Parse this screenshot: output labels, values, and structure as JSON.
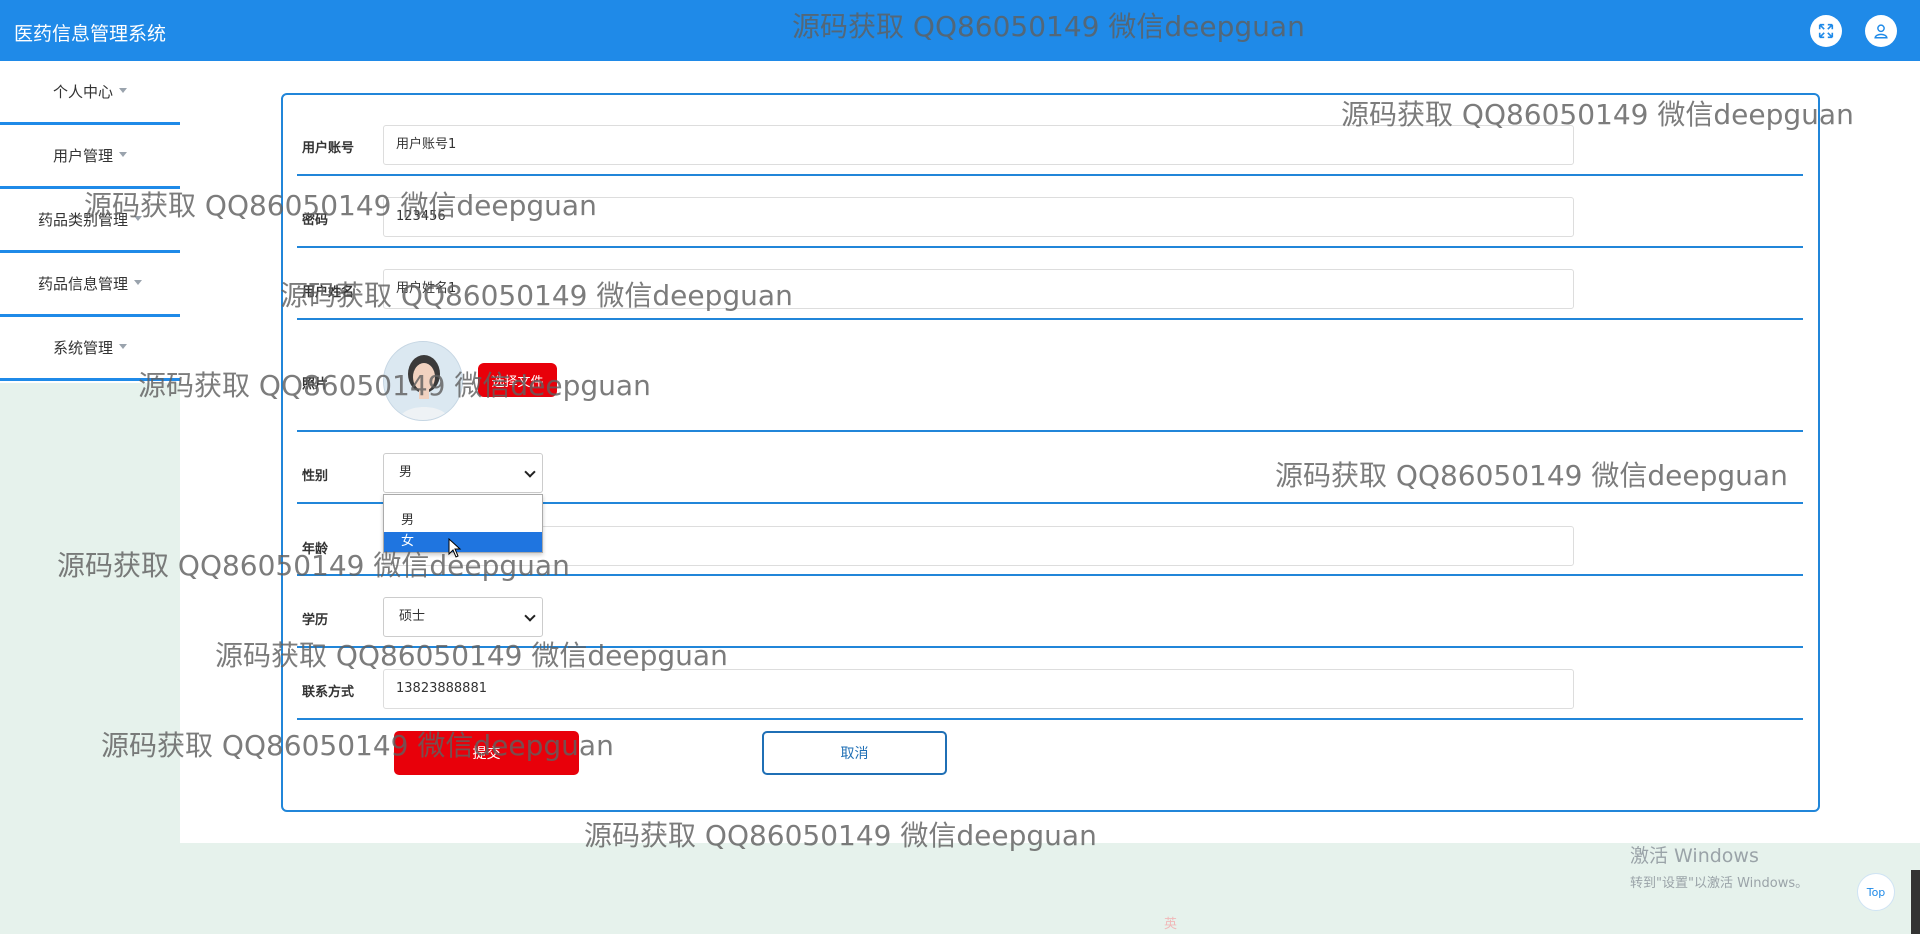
{
  "header": {
    "app_title": "医药信息管理系统"
  },
  "sidebar": {
    "items": [
      {
        "label": "个人中心"
      },
      {
        "label": "用户管理"
      },
      {
        "label": "药品类别管理"
      },
      {
        "label": "药品信息管理"
      },
      {
        "label": "系统管理"
      }
    ]
  },
  "form": {
    "account_label": "用户账号",
    "account_value": "用户账号1",
    "password_label": "密码",
    "password_value": "123456",
    "name_label": "用户姓名",
    "name_value": "用户姓名1",
    "photo_label": "照片",
    "choose_file_label": "选择文件",
    "gender_label": "性别",
    "gender_value": "男",
    "gender_options": [
      "男",
      "女"
    ],
    "gender_highlighted": "女",
    "age_label": "年龄",
    "education_label": "学历",
    "education_value": "硕士",
    "contact_label": "联系方式",
    "contact_value": "13823888881",
    "submit_label": "提交",
    "cancel_label": "取消"
  },
  "watermark": {
    "text": "源码获取 QQ86050149 微信deepguan"
  },
  "system": {
    "activate_title": "激活 Windows",
    "activate_sub": "转到\"设置\"以激活 Windows。",
    "top_button": "Top",
    "ime_text": "英"
  },
  "colors": {
    "header_bg": "#1f8ae8",
    "accent_line": "#2186d9",
    "submit_bg": "#e8000a",
    "page_bg": "#e6f2ec"
  }
}
